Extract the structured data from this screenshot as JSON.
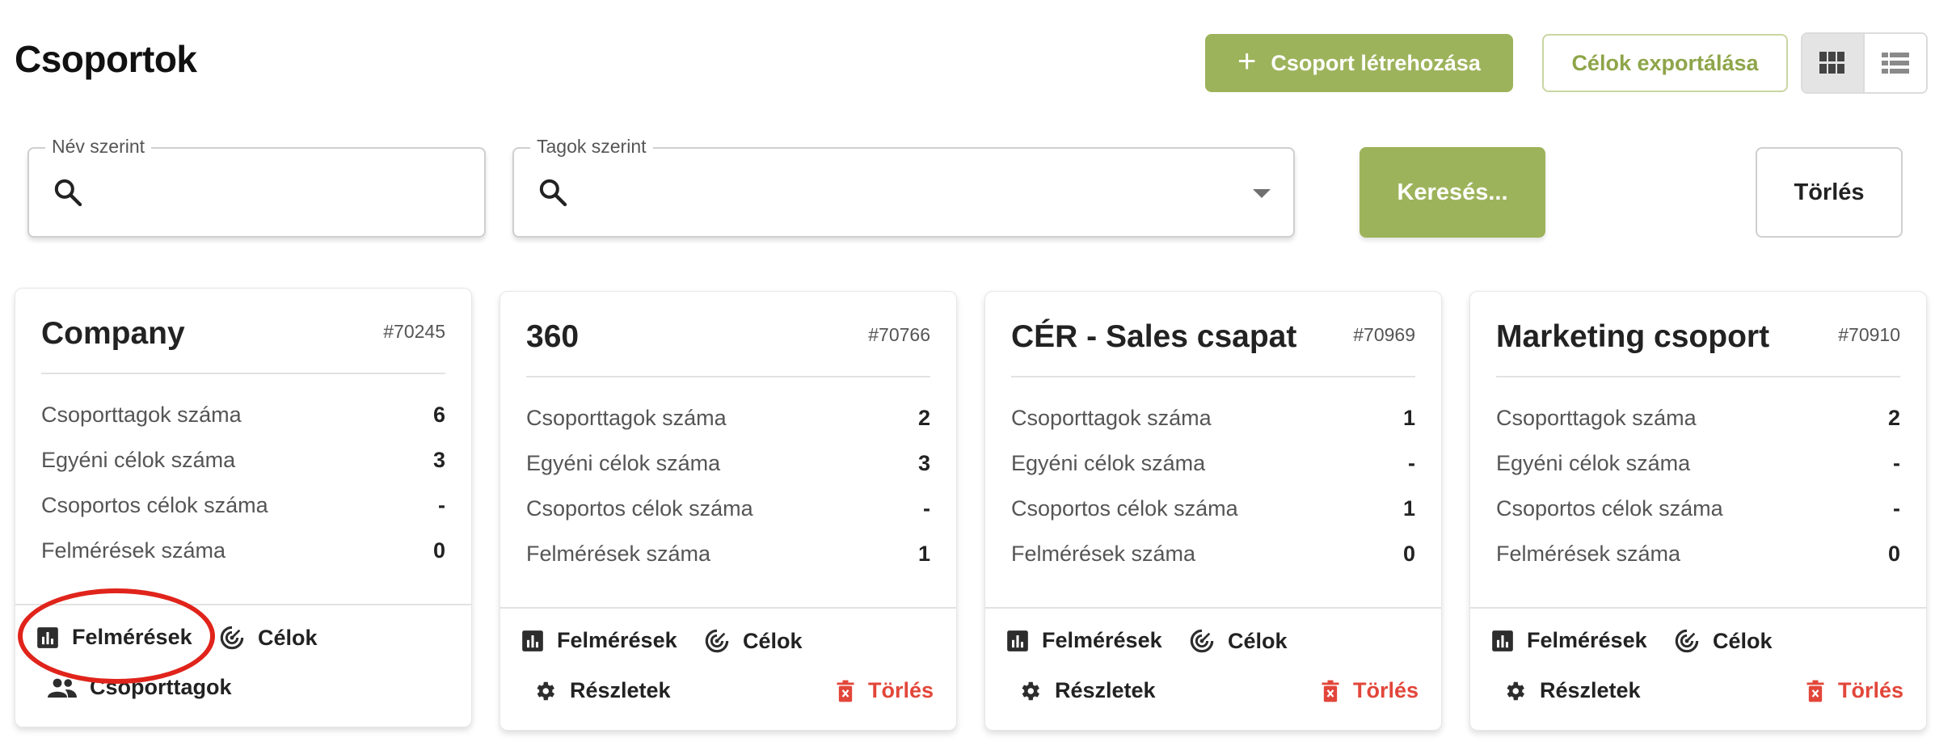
{
  "header": {
    "title": "Csoportok",
    "create_button": "Csoport létrehozása",
    "export_button": "Célok exportálása"
  },
  "filters": {
    "name_label": "Név szerint",
    "name_value": "",
    "members_label": "Tagok szerint",
    "members_value": "",
    "search_button": "Keresés...",
    "clear_button": "Törlés"
  },
  "labels": {
    "members_count": "Csoporttagok száma",
    "individual_goals": "Egyéni célok száma",
    "group_goals": "Csoportos célok száma",
    "surveys_count": "Felmérések száma",
    "surveys": "Felmérések",
    "goals": "Célok",
    "group_members": "Csoporttagok",
    "details": "Részletek",
    "delete": "Törlés"
  },
  "cards": [
    {
      "name": "Company",
      "id": "#70245",
      "members": "6",
      "individual_goals": "3",
      "group_goals": "-",
      "surveys": "0"
    },
    {
      "name": "360",
      "id": "#70766",
      "members": "2",
      "individual_goals": "3",
      "group_goals": "-",
      "surveys": "1"
    },
    {
      "name": "CÉR - Sales csapat",
      "id": "#70969",
      "members": "1",
      "individual_goals": "-",
      "group_goals": "1",
      "surveys": "0"
    },
    {
      "name": "Marketing csoport",
      "id": "#70910",
      "members": "2",
      "individual_goals": "-",
      "group_goals": "-",
      "surveys": "0"
    }
  ],
  "colors": {
    "primary": "#9db35b",
    "danger": "#e2463a",
    "highlight": "#e0241b"
  },
  "icons": [
    "plus-icon",
    "grid-view-icon",
    "list-view-icon",
    "search-icon",
    "dropdown-caret-icon",
    "bar-chart-icon",
    "target-icon",
    "people-icon",
    "gear-icon",
    "trash-icon"
  ]
}
